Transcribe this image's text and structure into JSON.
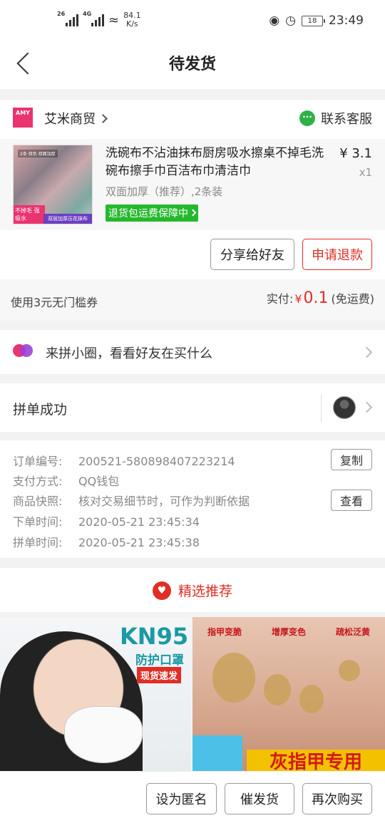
{
  "status_bar": {
    "sig1_label": "26",
    "sig2_label": "4G",
    "speed_value": "84.1",
    "speed_unit": "K/s",
    "battery": "18",
    "time": "23:49"
  },
  "nav": {
    "title": "待发货"
  },
  "shop": {
    "logo_text": "AMY",
    "name": "艾米商贸",
    "contact_label": "联系客服"
  },
  "product": {
    "title": "洗碗布不沾油抹布厨房吸水擦桌不掉毛洗碗布擦手巾百洁布巾清洁巾",
    "spec": "双面加厚（推荐）,2条装",
    "badge": "退货包运费保障中",
    "price": "¥ 3.1",
    "qty": "x1",
    "image_tags": [
      "不掉毛 强吸水",
      "双层加厚压花抹布"
    ]
  },
  "actions": {
    "share": "分享给好友",
    "refund": "申请退款"
  },
  "payment": {
    "coupon": "使用3元无门槛券",
    "paid_label": "实付:",
    "currency": "¥",
    "amount": "0.1",
    "shipping": "(免运费)"
  },
  "circle": {
    "text": "来拼小圈，看看好友在买什么"
  },
  "group": {
    "text": "拼单成功"
  },
  "order_info": {
    "rows": [
      {
        "key": "订单编号:",
        "value": "200521-580898407223214"
      },
      {
        "key": "支付方式:",
        "value": "QQ钱包"
      },
      {
        "key": "商品快照:",
        "value": "核对交易细节时，可作为判断依据"
      },
      {
        "key": "下单时间:",
        "value": "2020-05-21 23:45:34"
      },
      {
        "key": "拼单时间:",
        "value": "2020-05-21 23:45:38"
      }
    ],
    "copy_label": "复制",
    "view_label": "查看"
  },
  "recommend": {
    "title": "精选推荐"
  },
  "ads": {
    "left": {
      "title": "KN95",
      "subtitle": "防护口罩",
      "tag": "现货速发"
    },
    "right": {
      "labels": [
        "指甲变脆",
        "增厚变色",
        "疏松泛黄"
      ],
      "banner": "灰指甲专用"
    }
  },
  "bottom_bar": {
    "anonymous": "设为匿名",
    "urge": "催发货",
    "rebuy": "再次购买"
  },
  "colors": {
    "accent": "#e02e24",
    "green": "#25b82d",
    "brand_pink": "#e93470"
  }
}
